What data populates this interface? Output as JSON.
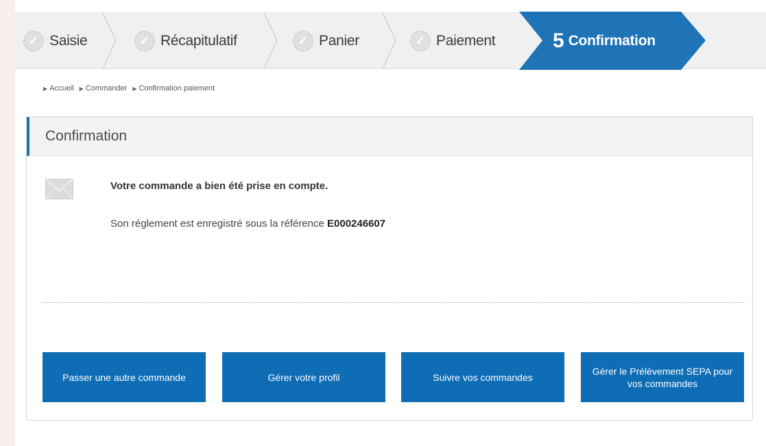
{
  "stepper": {
    "steps": [
      {
        "label": "Saisie"
      },
      {
        "label": "Récapitulatif"
      },
      {
        "label": "Panier"
      },
      {
        "label": "Paiement"
      }
    ],
    "active": {
      "number": "5",
      "label": "Confirmation"
    },
    "check_glyph": "✓",
    "active_color": "#1f73b7"
  },
  "breadcrumb": [
    "Accueil",
    "Commander",
    "Confirmation paiement"
  ],
  "panel": {
    "title": "Confirmation",
    "message_title": "Votre commande a bien été prise en compte.",
    "reference_text": "Son réglement est enregistré sous la référence ",
    "reference_code": "E000246607"
  },
  "buttons": [
    {
      "label": "Passer une autre commande"
    },
    {
      "label": "Gérer votre profil"
    },
    {
      "label": "Suivre vos commandes"
    },
    {
      "label": "Gérer le Prélèvement SEPA pour vos commandes"
    }
  ],
  "colors": {
    "button_blue": "#0f6db5",
    "accent_blue": "#1f73b7"
  },
  "icons": {
    "step_done": "check-circle-icon",
    "breadcrumb_separator": "triangle-right-icon",
    "message": "envelope-icon"
  }
}
